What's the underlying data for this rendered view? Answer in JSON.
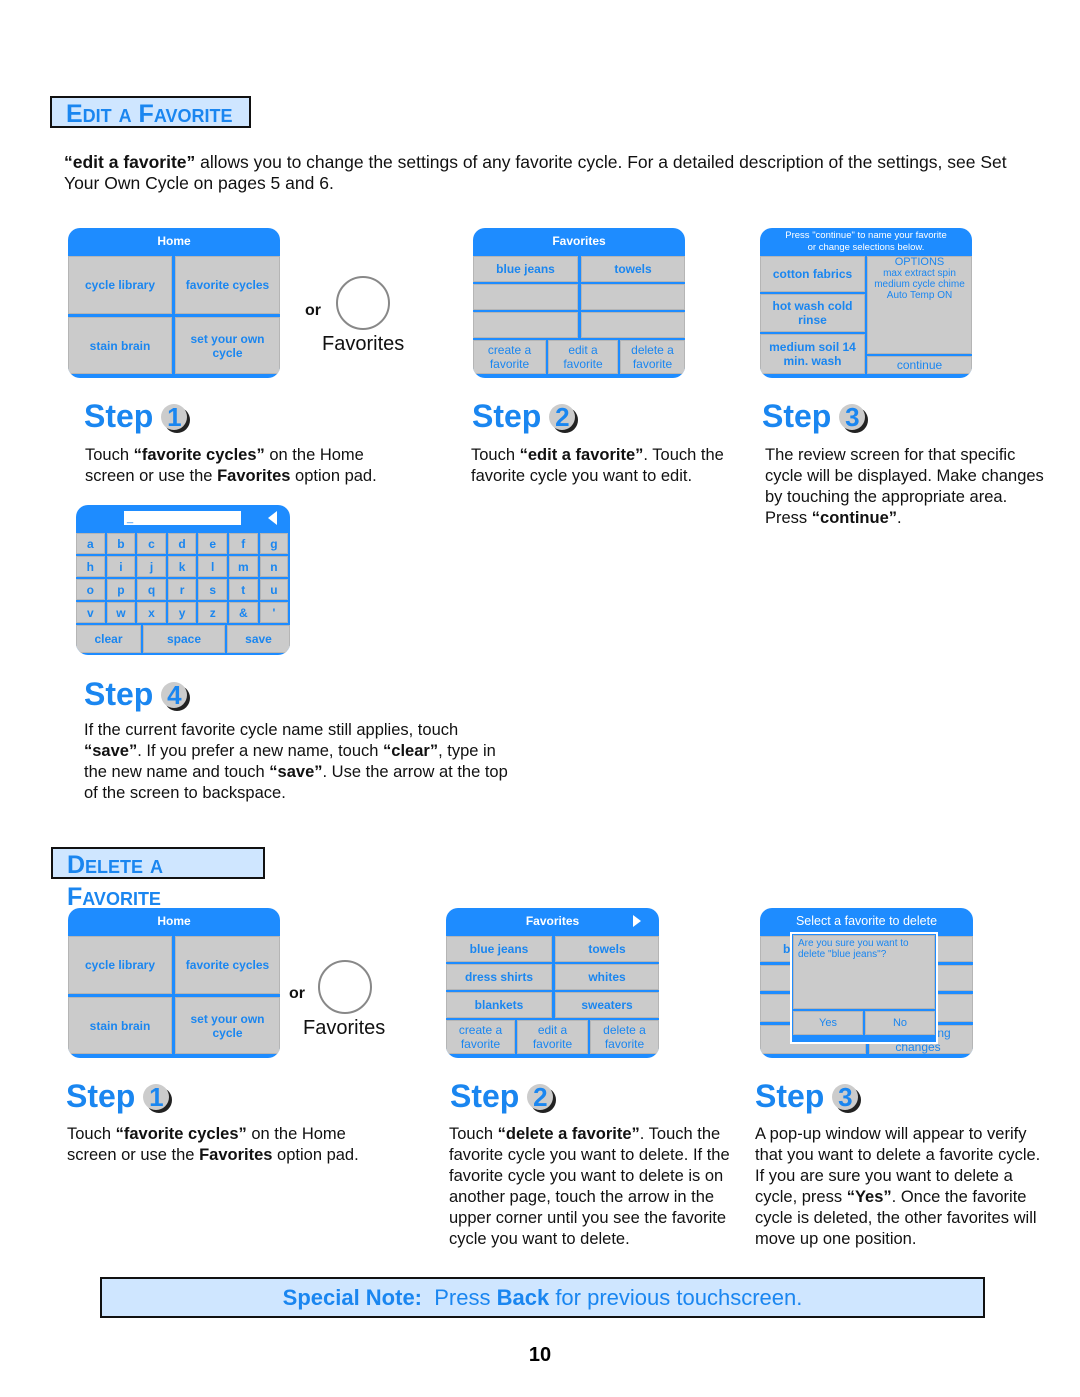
{
  "edit_section": {
    "title": "Edit a Favorite",
    "intro_bold": "“edit a favorite”",
    "intro_rest": " allows you to change the settings of any favorite cycle.  For a detailed description of the settings, see Set Your Own Cycle on pages 5 and 6.",
    "or": "or",
    "favorites_pad": "Favorites",
    "home": {
      "title": "Home",
      "cells": [
        "cycle library",
        "favorite cycles",
        "stain brain",
        "set your own cycle"
      ]
    },
    "favorites": {
      "title": "Favorites",
      "rows": [
        "blue jeans",
        "towels"
      ],
      "buttons": [
        "create a favorite",
        "edit a favorite",
        "delete a favorite"
      ]
    },
    "review": {
      "title": "Press \"continue\" to name your favorite or change selections below.",
      "left": [
        "cotton fabrics",
        "hot wash cold rinse",
        "medium soil 14 min. wash"
      ],
      "options_title": "OPTIONS",
      "options": [
        "max extract spin",
        "medium cycle chime",
        "Auto Temp ON"
      ],
      "continue": "continue"
    },
    "keyboard": {
      "input": "_",
      "keys": [
        "a",
        "b",
        "c",
        "d",
        "e",
        "f",
        "g",
        "h",
        "i",
        "j",
        "k",
        "l",
        "m",
        "n",
        "o",
        "p",
        "q",
        "r",
        "s",
        "t",
        "u",
        "v",
        "w",
        "x",
        "y",
        "z",
        "&",
        "'"
      ],
      "clear": "clear",
      "space": "space",
      "save": "save"
    },
    "steps": [
      {
        "label": "Step",
        "num": "1",
        "parts": [
          "Touch ",
          "“favorite cycles”",
          " on the Home screen or use the ",
          "Favorites",
          " option pad."
        ]
      },
      {
        "label": "Step",
        "num": "2",
        "parts": [
          "Touch ",
          "“edit a favorite”",
          ".  Touch the favorite cycle you want to edit."
        ]
      },
      {
        "label": "Step",
        "num": "3",
        "parts": [
          "The review screen for that specific cycle will be displayed.  Make changes by touching the appropriate area.  Press ",
          "“continue”",
          "."
        ]
      },
      {
        "label": "Step",
        "num": "4",
        "parts": [
          "If the current favorite cycle name still applies, touch ",
          "“save”",
          ".  If you prefer a new name, touch ",
          "“clear”",
          ", type in the new name and touch ",
          "“save”",
          ".  Use the arrow at the top of the screen to backspace."
        ]
      }
    ]
  },
  "delete_section": {
    "title": "Delete a Favorite",
    "or": "or",
    "favorites_pad": "Favorites",
    "home": {
      "title": "Home",
      "cells": [
        "cycle library",
        "favorite cycles",
        "stain brain",
        "set your own cycle"
      ]
    },
    "favorites": {
      "title": "Favorites",
      "rows": [
        "blue jeans",
        "towels",
        "dress shirts",
        "whites",
        "blankets",
        "sweaters"
      ],
      "buttons": [
        "create a favorite",
        "edit a favorite",
        "delete a favorite"
      ]
    },
    "popup": {
      "title": "Select a favorite to delete",
      "behind_left": "b",
      "behind_right": "hout making changes",
      "question": "Are you sure you want to delete \"blue jeans\"?",
      "yes": "Yes",
      "no": "No"
    },
    "steps": [
      {
        "label": "Step",
        "num": "1",
        "parts": [
          "Touch ",
          "“favorite cycles”",
          " on the Home screen or use the ",
          "Favorites",
          " option pad."
        ]
      },
      {
        "label": "Step",
        "num": "2",
        "parts": [
          "Touch ",
          "“delete a favorite”",
          ".  Touch the favorite cycle you want to delete.  If the favorite cycle you want to delete is on another page, touch the arrow in the upper corner until you see the favorite cycle you want to delete."
        ]
      },
      {
        "label": "Step",
        "num": "3",
        "parts": [
          "A pop-up window will appear to verify that you want to delete a favorite cycle.  If you are sure you want to delete a cycle, press ",
          "“Yes”",
          ".  Once the favorite cycle is deleted, the other favorites will move up one position."
        ]
      }
    ]
  },
  "note": {
    "label": "Special Note:",
    "pre": "Press ",
    "bold": "Back",
    "post": " for previous touchscreen."
  },
  "page_number": "10",
  "colors": {
    "accent": "#1e8cff",
    "section_bg": "#cfe6ff",
    "cell": "#cbcbcb"
  }
}
